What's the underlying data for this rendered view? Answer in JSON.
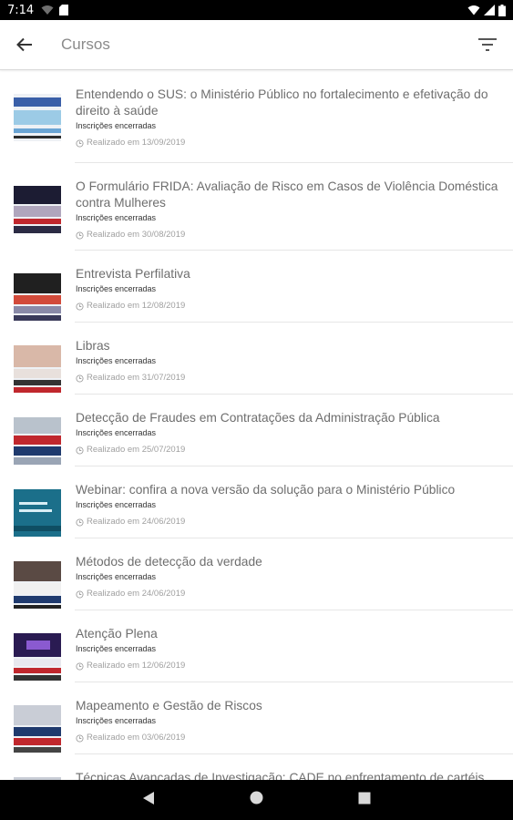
{
  "status_bar": {
    "time": "7:14"
  },
  "app_bar": {
    "title": "Cursos"
  },
  "colors": {
    "accent_navy": "#1f3a6e",
    "accent_red": "#c0272d",
    "teal": "#1b6f8a"
  },
  "courses": [
    {
      "title": "Entendendo o SUS: o Ministério Público no fortalecimento e efetivação do direito à saúde",
      "status": "Inscrições encerradas",
      "date": "Realizado em 13/09/2019"
    },
    {
      "title": "O Formulário FRIDA: Avaliação de Risco em Casos de Violência Doméstica contra Mulheres",
      "status": "Inscrições encerradas",
      "date": "Realizado em 30/08/2019"
    },
    {
      "title": "Entrevista Perfilativa",
      "status": "Inscrições encerradas",
      "date": "Realizado em 12/08/2019"
    },
    {
      "title": "Libras",
      "status": "Inscrições encerradas",
      "date": "Realizado em 31/07/2019"
    },
    {
      "title": "Detecção de Fraudes em Contratações da Administração Pública",
      "status": "Inscrições encerradas",
      "date": "Realizado em 25/07/2019"
    },
    {
      "title": "Webinar: confira a nova versão da solução para o Ministério Público",
      "status": "Inscrições encerradas",
      "date": "Realizado em 24/06/2019"
    },
    {
      "title": "Métodos de detecção da verdade",
      "status": "Inscrições encerradas",
      "date": "Realizado em 24/06/2019"
    },
    {
      "title": "Atenção Plena",
      "status": "Inscrições encerradas",
      "date": "Realizado em 12/06/2019"
    },
    {
      "title": "Mapeamento e Gestão de Riscos",
      "status": "Inscrições encerradas",
      "date": "Realizado em 03/06/2019"
    },
    {
      "title": "Técnicas Avançadas de Investigação: CADE no enfrentamento de cartéis",
      "status": "",
      "date": ""
    }
  ]
}
